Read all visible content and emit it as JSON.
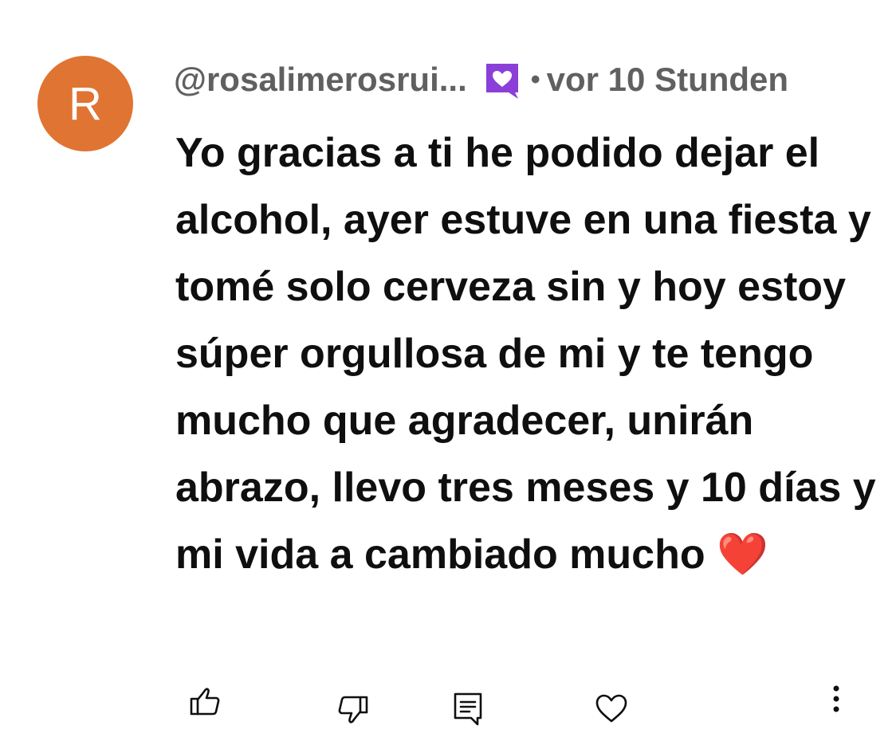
{
  "author": {
    "avatar_letter": "R",
    "avatar_color": "#e07432",
    "handle": "@rosalimerosrui...",
    "badge_icon": "member-badge-heart-icon",
    "badge_color": "#8b3fd9",
    "separator": "•",
    "timestamp": "vor 10 Stunden"
  },
  "comment": {
    "text": "Yo gracias a ti he podido dejar el alcohol, ayer estuve en una fiesta y tomé solo cerveza sin y hoy estoy súper orgullosa de mi y te tengo mucho que agradecer, unirán abrazo, llevo tres meses y 10 días y mi vida a cambiado mucho",
    "emoji": "❤️"
  },
  "actions": {
    "like_icon": "thumbs-up-icon",
    "dislike_icon": "thumbs-down-icon",
    "reply_icon": "reply-comment-icon",
    "heart_icon": "heart-icon",
    "more_icon": "more-vertical-icon"
  }
}
